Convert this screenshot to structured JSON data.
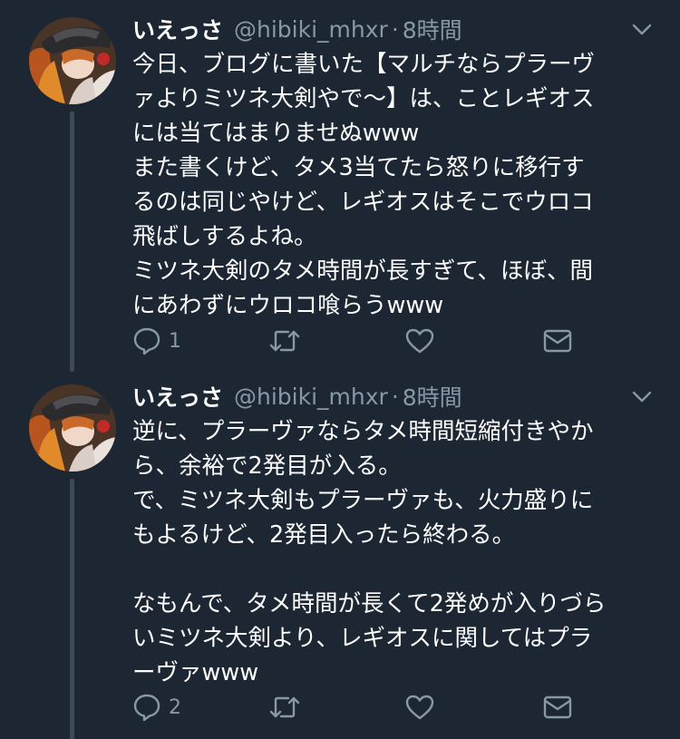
{
  "tweets": [
    {
      "name": "いえっさ",
      "handle": "@hibiki_mhxr",
      "separator": "·",
      "time": "8時間",
      "lines": [
        "今日、ブログに書いた【マルチならプラーヴ",
        "ァよりミツネ大剣やで〜】は、ことレギオス",
        "には当てはまりませぬwww",
        "また書くけど、タメ3当てたら怒りに移行す",
        "るのは同じやけど、レギオスはそこでウロコ",
        "飛ばしするよね。",
        "ミツネ大剣のタメ時間が長すぎて、ほぼ、間",
        "にあわずにウロコ喰らうwww"
      ],
      "reply_count": "1",
      "icons": {
        "reply": "reply-bubble-icon",
        "retweet": "retweet-icon",
        "like": "heart-icon",
        "dm": "envelope-icon",
        "more": "chevron-down-icon"
      }
    },
    {
      "name": "いえっさ",
      "handle": "@hibiki_mhxr",
      "separator": "·",
      "time": "8時間",
      "lines": [
        "逆に、プラーヴァならタメ時間短縮付きやか",
        "ら、余裕で2発目が入る。",
        "で、ミツネ大剣もプラーヴァも、火力盛りに",
        "もよるけど、2発目入ったら終わる。",
        "",
        "なもんで、タメ時間が長くて2発めが入りづら",
        "いミツネ大剣より、レギオスに関してはプラ",
        "ーヴァwww"
      ],
      "reply_count": "2",
      "icons": {
        "reply": "reply-bubble-icon",
        "retweet": "retweet-icon",
        "like": "heart-icon",
        "dm": "envelope-icon",
        "more": "chevron-down-icon"
      }
    }
  ],
  "colors": {
    "background": "#1c2733",
    "text": "#ffffff",
    "secondary": "#8899a6",
    "thread_line": "#3b4a58"
  }
}
